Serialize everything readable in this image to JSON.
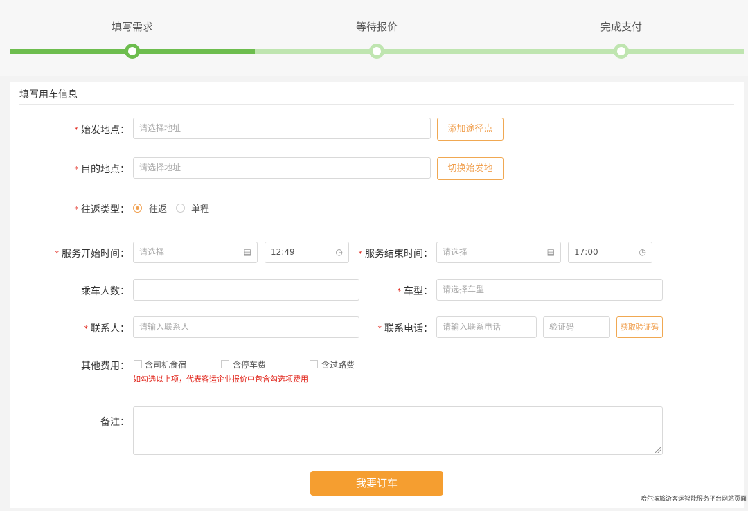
{
  "steps": {
    "items": [
      {
        "label": "填写需求",
        "state": "done"
      },
      {
        "label": "等待报价",
        "state": "todo"
      },
      {
        "label": "完成支付",
        "state": "todo"
      }
    ],
    "active_color": "#6dbd4e",
    "inactive_color": "#bfe5b0"
  },
  "form": {
    "section_title": "填写用车信息",
    "required_mark": "*",
    "origin": {
      "label": "始发地点：",
      "placeholder": "请选择地址",
      "button": "添加途径点"
    },
    "destination": {
      "label": "目的地点：",
      "placeholder": "请选择地址",
      "button": "切换始发地"
    },
    "trip_type": {
      "label": "往返类型：",
      "options": [
        {
          "label": "往返",
          "selected": true
        },
        {
          "label": "单程",
          "selected": false
        }
      ]
    },
    "start_time": {
      "label": "服务开始时间：",
      "date_placeholder": "请选择",
      "time_value": "12:49"
    },
    "end_time": {
      "label": "服务结束时间：",
      "date_placeholder": "请选择",
      "time_value": "17:00"
    },
    "passengers": {
      "label": "乘车人数：",
      "value": ""
    },
    "vehicle_type": {
      "label": "车型：",
      "placeholder": "请选择车型"
    },
    "contact": {
      "label": "联系人：",
      "placeholder": "请输入联系人"
    },
    "phone": {
      "label": "联系电话：",
      "placeholder": "请输入联系电话",
      "code_placeholder": "验证码",
      "code_button": "获取验证码"
    },
    "other_fees": {
      "label": "其他费用：",
      "options": [
        {
          "label": "含司机食宿",
          "checked": false
        },
        {
          "label": "含停车费",
          "checked": false
        },
        {
          "label": "含过路费",
          "checked": false
        }
      ],
      "hint": "如勾选以上项，代表客运企业报价中包含勾选项费用"
    },
    "remarks": {
      "label": "备注：",
      "value": ""
    },
    "submit_label": "我要订车"
  },
  "icons": {
    "calendar": "calendar-icon",
    "clock": "clock-icon"
  },
  "footer_caption": "哈尔滨旅游客运智能服务平台网站页面",
  "accent_color": "#f59e30"
}
